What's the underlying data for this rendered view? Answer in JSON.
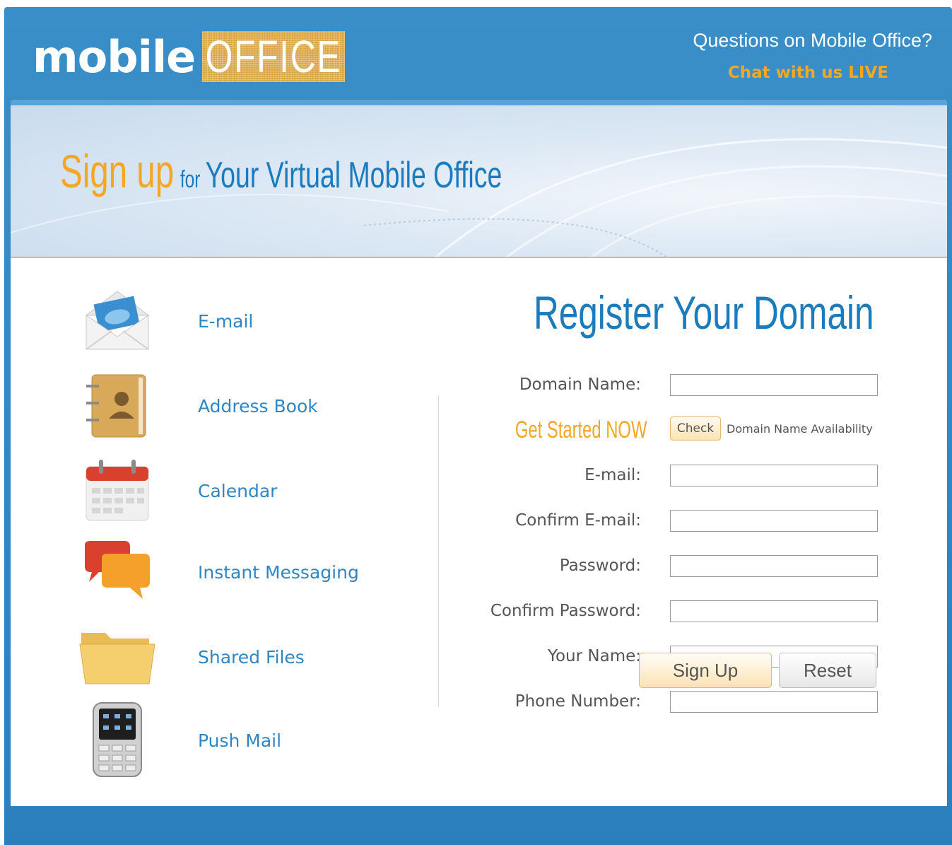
{
  "header": {
    "logo_mobile": "mobile",
    "logo_office": "OFFICE",
    "questions": "Questions on Mobile Office?",
    "chat": "Chat with us LIVE"
  },
  "banner": {
    "sign_up": "Sign up",
    "for": "for",
    "rest": "Your Virtual Mobile Office"
  },
  "features": [
    {
      "label": "E-mail",
      "icon": "envelope-icon"
    },
    {
      "label": "Address Book",
      "icon": "address-book-icon"
    },
    {
      "label": "Calendar",
      "icon": "calendar-icon"
    },
    {
      "label": "Instant Messaging",
      "icon": "chat-bubbles-icon"
    },
    {
      "label": "Shared Files",
      "icon": "folder-icon"
    },
    {
      "label": "Push Mail",
      "icon": "mobile-phone-icon"
    }
  ],
  "form": {
    "title": "Register Your Domain",
    "domain_label": "Domain Name:",
    "get_started": "Get Started NOW",
    "check_label": "Check",
    "availability": "Domain Name Availability",
    "email_label": "E-mail:",
    "confirm_email_label": "Confirm E-mail:",
    "password_label": "Password:",
    "confirm_password_label": "Confirm Password:",
    "name_label": "Your Name:",
    "phone_label": "Phone Number:",
    "signup_label": "Sign Up",
    "reset_label": "Reset"
  },
  "colors": {
    "brand_blue": "#2c7fbd",
    "accent_orange": "#f5a623",
    "text_blue": "#1a7bbf"
  }
}
